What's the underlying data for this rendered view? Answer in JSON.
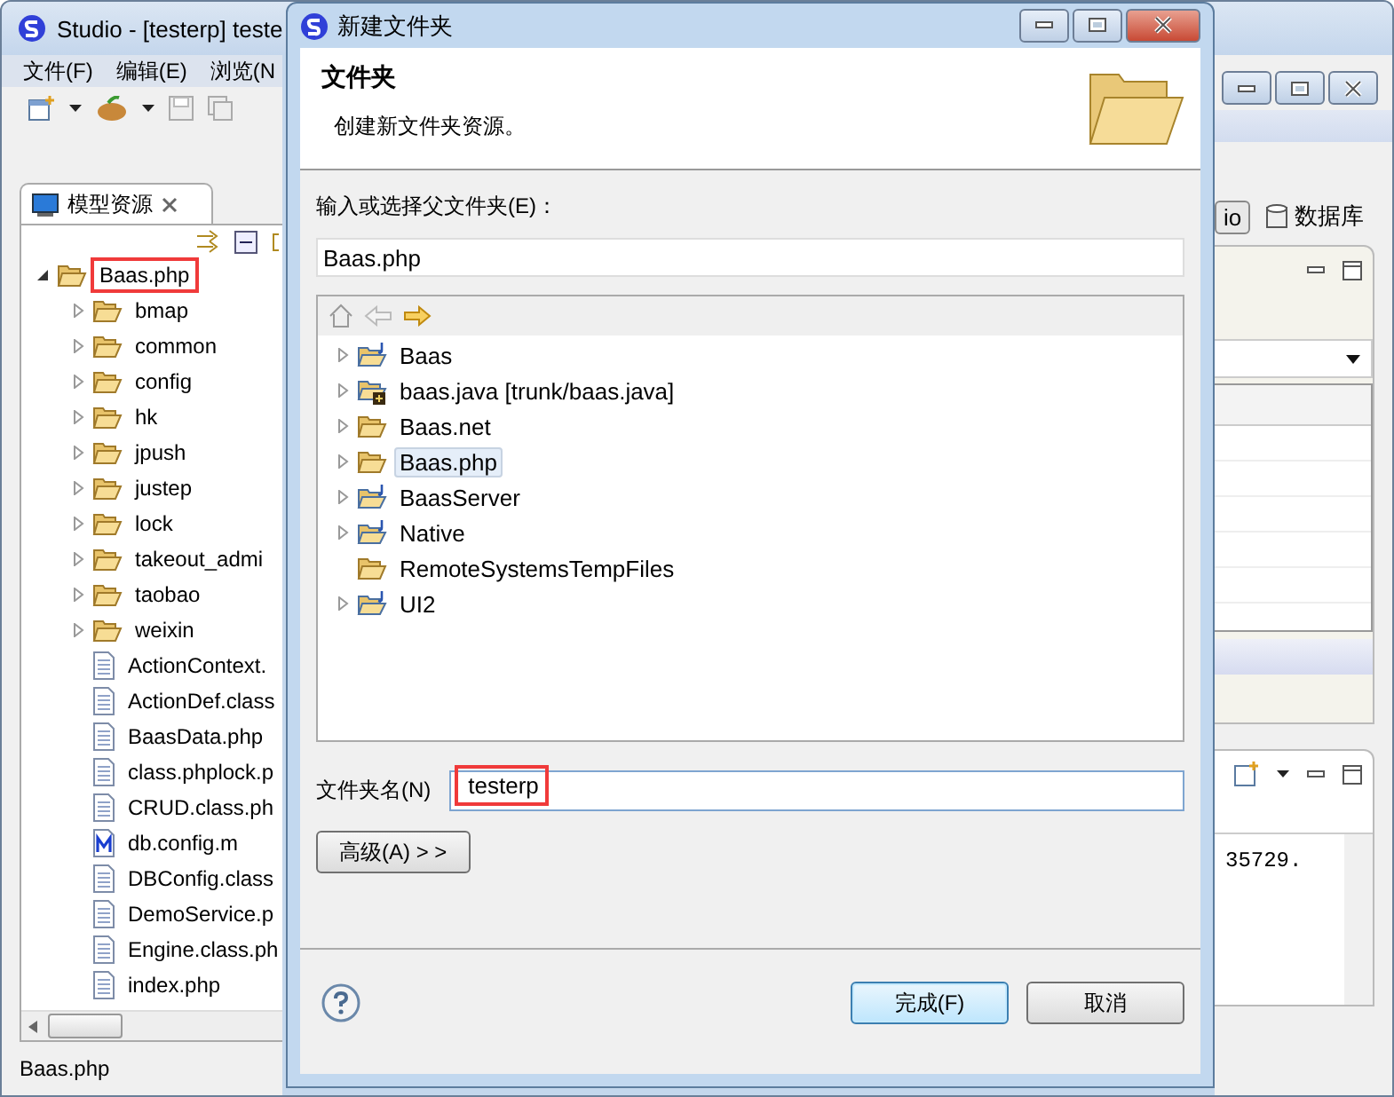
{
  "ide": {
    "title": "Studio - [testerp] teste",
    "menu": [
      "文件(F)",
      "编辑(E)",
      "浏览(N"
    ],
    "panel_tab": "模型资源",
    "tree": [
      {
        "label": "Baas.php",
        "kind": "folder",
        "expanded": true,
        "highlighted": true,
        "children": [
          {
            "label": "bmap",
            "kind": "folder",
            "expanded": false
          },
          {
            "label": "common",
            "kind": "folder",
            "expanded": false
          },
          {
            "label": "config",
            "kind": "folder",
            "expanded": false
          },
          {
            "label": "hk",
            "kind": "folder",
            "expanded": false
          },
          {
            "label": "jpush",
            "kind": "folder",
            "expanded": false
          },
          {
            "label": "justep",
            "kind": "folder",
            "expanded": false
          },
          {
            "label": "lock",
            "kind": "folder",
            "expanded": false
          },
          {
            "label": "takeout_admi",
            "kind": "folder",
            "expanded": false
          },
          {
            "label": "taobao",
            "kind": "folder",
            "expanded": false
          },
          {
            "label": "weixin",
            "kind": "folder",
            "expanded": false
          },
          {
            "label": "ActionContext.",
            "kind": "file"
          },
          {
            "label": "ActionDef.class",
            "kind": "file"
          },
          {
            "label": "BaasData.php",
            "kind": "file"
          },
          {
            "label": "class.phplock.p",
            "kind": "file"
          },
          {
            "label": "CRUD.class.ph",
            "kind": "file"
          },
          {
            "label": "db.config.m",
            "kind": "mfile"
          },
          {
            "label": "DBConfig.class",
            "kind": "file"
          },
          {
            "label": "DemoService.p",
            "kind": "file"
          },
          {
            "label": "Engine.class.ph",
            "kind": "file"
          },
          {
            "label": "index.php",
            "kind": "file"
          }
        ]
      }
    ],
    "status_bar": "Baas.php",
    "perspectives": [
      {
        "label": "io",
        "selected": true
      },
      {
        "label": "数据库",
        "selected": false
      }
    ],
    "console_text": "35729."
  },
  "dialog": {
    "title": "新建文件夹",
    "heading": "文件夹",
    "description": "创建新文件夹资源。",
    "parent_label": "输入或选择父文件夹(E)：",
    "parent_value": "Baas.php",
    "folders": [
      {
        "label": "Baas",
        "kind": "project",
        "expandable": true,
        "selected": false
      },
      {
        "label": "baas.java [trunk/baas.java]",
        "kind": "shared",
        "expandable": true,
        "selected": false
      },
      {
        "label": "Baas.net",
        "kind": "folder",
        "expandable": true,
        "selected": false
      },
      {
        "label": "Baas.php",
        "kind": "folder",
        "expandable": true,
        "selected": true
      },
      {
        "label": "BaasServer",
        "kind": "project",
        "expandable": true,
        "selected": false
      },
      {
        "label": "Native",
        "kind": "project",
        "expandable": true,
        "selected": false
      },
      {
        "label": "RemoteSystemsTempFiles",
        "kind": "folder",
        "expandable": false,
        "selected": false
      },
      {
        "label": "UI2",
        "kind": "project",
        "expandable": true,
        "selected": false
      }
    ],
    "name_label": "文件夹名(N)",
    "name_value": "testerp",
    "name_highlighted": true,
    "buttons": [
      {
        "label": "高级(A) > >",
        "kind": "advanced"
      },
      {
        "label": "完成(F)",
        "kind": "default"
      },
      {
        "label": "取消",
        "kind": "normal"
      }
    ]
  }
}
